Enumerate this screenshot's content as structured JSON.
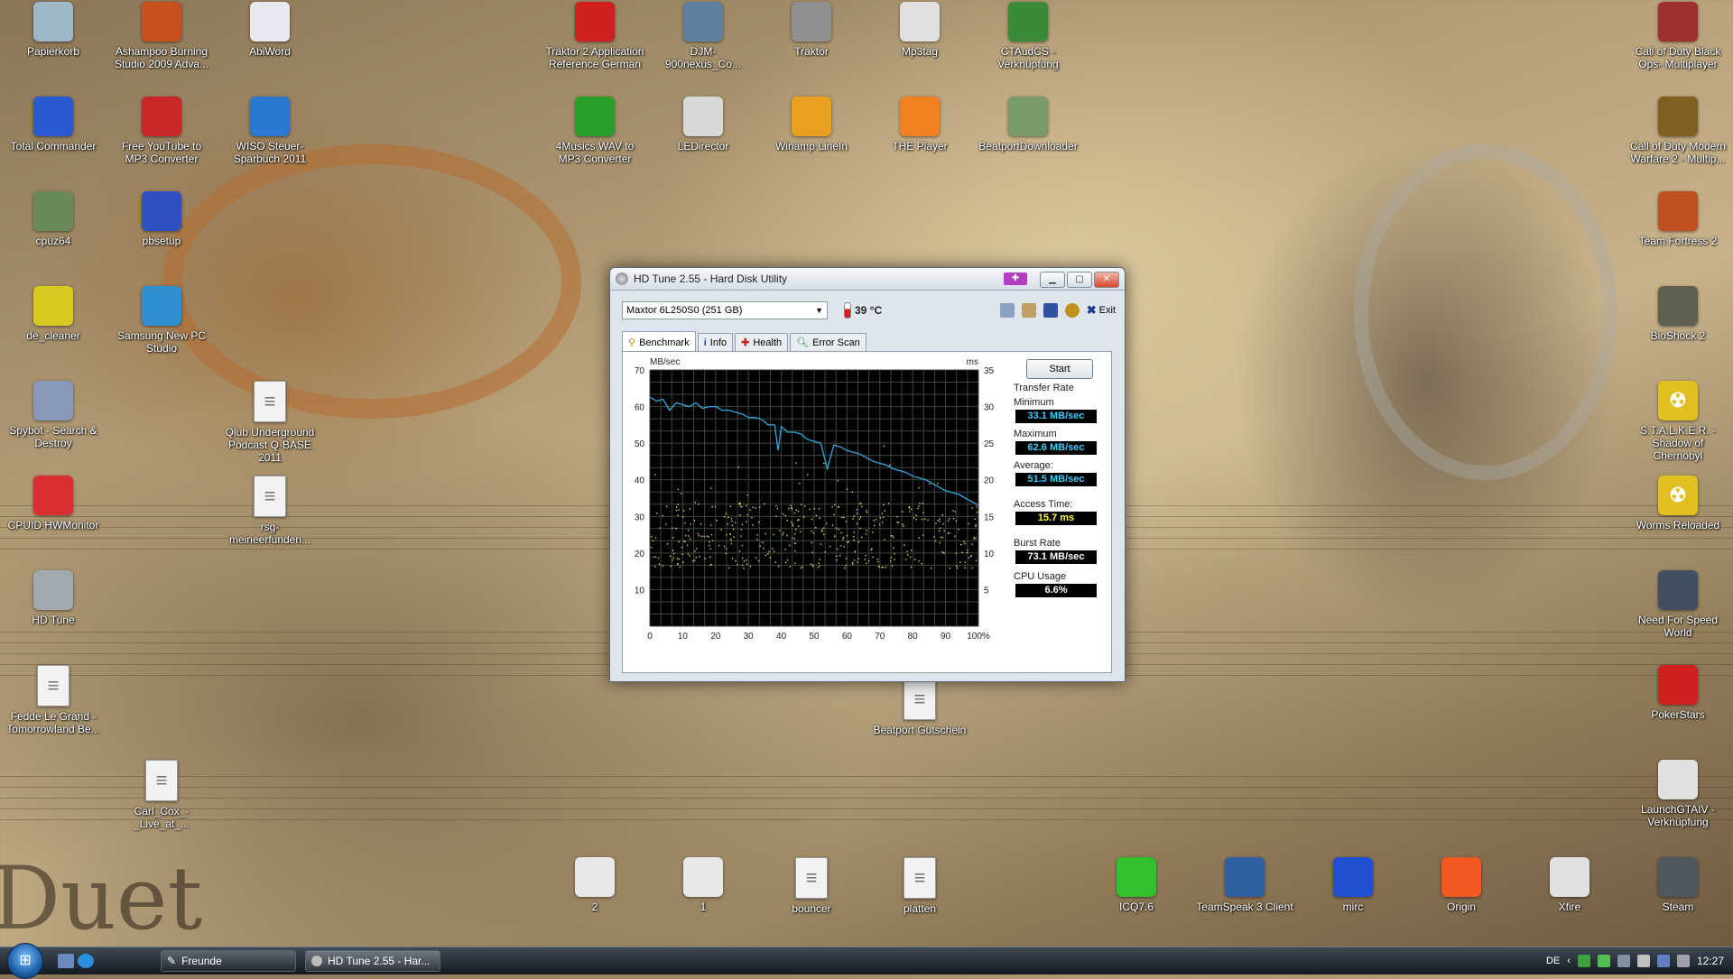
{
  "desktop": {
    "icons_left_col1": [
      {
        "label": "Papierkorb",
        "icon": "recycle-bin-icon",
        "color": "#9fb8c8"
      },
      {
        "label": "Total Commander",
        "icon": "floppy-icon",
        "color": "#2a5ad0"
      },
      {
        "label": "cpuz64",
        "icon": "cpu-icon",
        "color": "#6a8a5a"
      },
      {
        "label": "de_cleaner",
        "icon": "cleaner-icon",
        "color": "#d8c820"
      },
      {
        "label": "Spybot - Search & Destroy",
        "icon": "spybot-icon",
        "color": "#8898b8"
      },
      {
        "label": "CPUID HWMonitor",
        "icon": "hwmonitor-icon",
        "color": "#d83030"
      },
      {
        "label": "HD Tune",
        "icon": "hdtune-icon",
        "color": "#a0a8b0"
      },
      {
        "label": "Fedde Le Grand - Tomorrowland Be...",
        "icon": "document-icon",
        "color": "#f2f2f2"
      }
    ],
    "icons_left_col2": [
      {
        "label": "Ashampoo Burning Studio 2009 Adva...",
        "icon": "ashampoo-icon",
        "color": "#c85020"
      },
      {
        "label": "Free YouTube to MP3 Converter",
        "icon": "youtube-mp3-icon",
        "color": "#c82828"
      },
      {
        "label": "pbsetup",
        "icon": "pbsetup-icon",
        "color": "#3050c0"
      },
      {
        "label": "Samsung New PC Studio",
        "icon": "samsung-icon",
        "color": "#3090d0"
      },
      {
        "label": "Carl_Cox_-_Live_at_...",
        "icon": "document-icon",
        "color": "#f2f2f2"
      }
    ],
    "icons_left_col3": [
      {
        "label": "AbiWord",
        "icon": "abiword-icon",
        "color": "#e8e8f0"
      },
      {
        "label": "WISO Steuer-Sparbuch 2011",
        "icon": "wiso-icon",
        "color": "#2a78d0"
      },
      {
        "label": "Qlub Underground Podcast Q-BASE 2011",
        "icon": "document-icon",
        "color": "#f2f2f2"
      },
      {
        "label": "rsg-meineerfunden...",
        "icon": "document-icon",
        "color": "#f2f2f2"
      }
    ],
    "icons_top_row": [
      {
        "label": "Traktor 2 Application Reference German",
        "icon": "pdf-icon",
        "color": "#d02020"
      },
      {
        "label": "DJM-900nexus_Co...",
        "icon": "speaker-settings-icon",
        "color": "#6080a0"
      },
      {
        "label": "Traktor",
        "icon": "traktor-icon",
        "color": "#909090"
      },
      {
        "label": "Mp3tag",
        "icon": "mp3tag-icon",
        "color": "#e0e0e0"
      },
      {
        "label": "CTAudCS - Verknüpfung",
        "icon": "soundcard-icon",
        "color": "#3a8a3a"
      }
    ],
    "icons_second_row": [
      {
        "label": "4Musics WAV to MP3 Converter",
        "icon": "4musics-icon",
        "color": "#2aa02a"
      },
      {
        "label": "LEDirector",
        "icon": "led-icon",
        "color": "#d8d8d8"
      },
      {
        "label": "Winamp LineIn",
        "icon": "winamp-icon",
        "color": "#e8a020"
      },
      {
        "label": "THE Player",
        "icon": "player-icon",
        "color": "#f08020"
      },
      {
        "label": "BeatportDownloader",
        "icon": "beatport-icon",
        "color": "#7a9a6a"
      }
    ],
    "icons_right_col": [
      {
        "label": "Call of Duty Black Ops- Multiplayer",
        "icon": "cod-blackops-icon",
        "color": "#a03030"
      },
      {
        "label": "Call of Duty Modern Warfare 2 - Multip...",
        "icon": "cod-mw2-icon",
        "color": "#806020"
      },
      {
        "label": "Team Fortress 2",
        "icon": "tf2-icon",
        "color": "#c05020"
      },
      {
        "label": "BioShock 2",
        "icon": "bioshock-icon",
        "color": "#606050"
      },
      {
        "label": "S.T.A.L.K.E.R. - Shadow of Chernobyl",
        "icon": "radiation-icon",
        "color": "#e0c020"
      },
      {
        "label": "Worms Reloaded",
        "icon": "radiation-icon",
        "color": "#e0c020"
      },
      {
        "label": "Need For Speed World",
        "icon": "nfs-icon",
        "color": "#405060"
      },
      {
        "label": "PokerStars",
        "icon": "pokerstars-icon",
        "color": "#d02020"
      },
      {
        "label": "LaunchGTAIV - Verknüpfung",
        "icon": "gta-icon",
        "color": "#e0e0e0"
      }
    ],
    "icons_bottom_row": [
      {
        "label": "2",
        "icon": "folder-icon",
        "color": "#e8e8e8"
      },
      {
        "label": "1",
        "icon": "folder-icon",
        "color": "#e8e8e8"
      },
      {
        "label": "bouncer",
        "icon": "document-icon",
        "color": "#f2f2f2"
      },
      {
        "label": "platten",
        "icon": "document-icon",
        "color": "#f2f2f2"
      },
      {
        "label": "ICQ7.6",
        "icon": "icq-icon",
        "color": "#30c030"
      },
      {
        "label": "TeamSpeak 3 Client",
        "icon": "teamspeak-icon",
        "color": "#3060a0"
      },
      {
        "label": "mirc",
        "icon": "mirc-icon",
        "color": "#2050d0"
      },
      {
        "label": "Origin",
        "icon": "origin-icon",
        "color": "#f05a20"
      },
      {
        "label": "Xfire",
        "icon": "xfire-icon",
        "color": "#e0e0e0"
      },
      {
        "label": "Steam",
        "icon": "steam-icon",
        "color": "#505860"
      }
    ],
    "icon_beatport_gutschein": {
      "label": "Beatport Gutschein",
      "icon": "document-icon",
      "color": "#f2f2f2"
    }
  },
  "window": {
    "title": "HD Tune 2.55 - Hard Disk Utility",
    "drive": "Maxtor  6L250S0 (251 GB)",
    "temperature": "39 °C",
    "exit_label": "Exit",
    "tabs": [
      "Benchmark",
      "Info",
      "Health",
      "Error Scan"
    ],
    "start_label": "Start",
    "stats": {
      "group_label": "Transfer Rate",
      "minimum_label": "Minimum",
      "minimum": "33.1 MB/sec",
      "maximum_label": "Maximum",
      "maximum": "62.6 MB/sec",
      "average_label": "Average:",
      "average": "51.5 MB/sec",
      "access_label": "Access Time:",
      "access": "15.7 ms",
      "burst_label": "Burst Rate",
      "burst": "73.1 MB/sec",
      "cpu_label": "CPU Usage",
      "cpu": "6.6%"
    }
  },
  "chart_data": {
    "type": "line",
    "ylabel_left": "MB/sec",
    "ylabel_right": "ms",
    "yticks_left": [
      "70",
      "60",
      "50",
      "40",
      "30",
      "20",
      "10"
    ],
    "yticks_right": [
      "35",
      "30",
      "25",
      "20",
      "15",
      "10",
      "5"
    ],
    "xticks": [
      "0",
      "10",
      "20",
      "30",
      "40",
      "50",
      "60",
      "70",
      "80",
      "90",
      "100%"
    ],
    "ylim_left": [
      0,
      70
    ],
    "ylim_right": [
      0,
      35
    ],
    "xlim": [
      0,
      100
    ],
    "grid": true,
    "background": "#000000",
    "grid_color": "#3a4a3a",
    "series": [
      {
        "line_color": "#2fa8e0",
        "x": [
          0,
          2,
          4,
          6,
          8,
          10,
          12,
          14,
          16,
          18,
          20,
          22,
          24,
          26,
          28,
          30,
          32,
          34,
          36,
          38,
          39,
          40,
          42,
          44,
          46,
          48,
          50,
          52,
          54,
          56,
          58,
          60,
          62,
          64,
          66,
          68,
          70,
          72,
          74,
          76,
          78,
          80,
          82,
          84,
          86,
          88,
          90,
          92,
          94,
          96,
          98,
          100
        ],
        "y": [
          62.6,
          61.5,
          62,
          59,
          61,
          60.5,
          60,
          61,
          59.5,
          60,
          60,
          59,
          59,
          58.5,
          58,
          57,
          57,
          56.5,
          55,
          55,
          48,
          54.5,
          53,
          53,
          52.5,
          51,
          50.5,
          50,
          43,
          49.5,
          49,
          48,
          47.5,
          47,
          46,
          45,
          44.5,
          44,
          43,
          42.5,
          42,
          41,
          40.5,
          40,
          39,
          38,
          37,
          36.5,
          36,
          35,
          34,
          33.1
        ]
      }
    ],
    "scatter_color": "#d8d860",
    "scatter_note_points": "access time samples mostly between 8 and 17 ms"
  },
  "taskbar": {
    "tasks": [
      "Freunde",
      "HD Tune 2.55 - Har..."
    ],
    "language": "DE",
    "clock": "12:27"
  }
}
